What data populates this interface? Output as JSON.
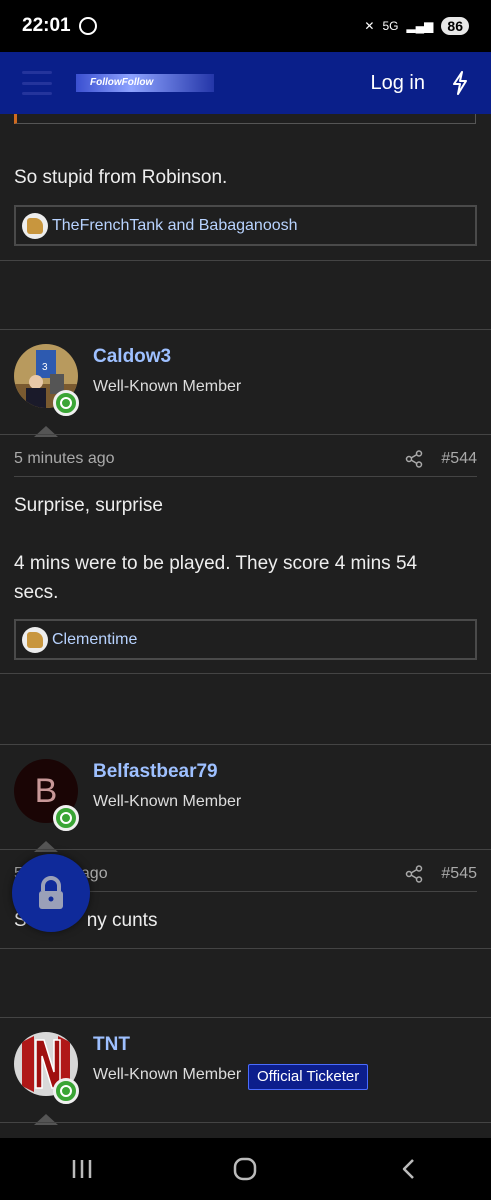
{
  "status": {
    "time": "22:01",
    "battery": "86",
    "network": "5G"
  },
  "header": {
    "logo_text": "FollowFollow",
    "login_label": "Log in"
  },
  "posts": [
    {
      "body": "So stupid from Robinson.",
      "reactions": "TheFrenchTank and Babaganoosh"
    },
    {
      "username": "Caldow3",
      "user_title": "Well-Known Member",
      "time_ago": "5 minutes ago",
      "post_number": "#544",
      "body_line1": "Surprise, surprise",
      "body_line2": "4 mins were to be played. They score 4 mins 54",
      "body_line3": "secs.",
      "reactions": "Clementime"
    },
    {
      "username": "Belfastbear79",
      "avatar_letter": "B",
      "user_title": "Well-Known Member",
      "time_ago": "5",
      "time_ago_tail": "ago",
      "post_number": "#545",
      "body_a": "S",
      "body_b": "ny cunts"
    },
    {
      "username": "TNT",
      "user_title": "Well-Known Member",
      "banner": "Official Ticketer"
    }
  ],
  "colors": {
    "accent": "#0a1f8a",
    "username": "#9ec0ff",
    "reaction_link": "#b8d3ff",
    "online": "#3aa535"
  }
}
